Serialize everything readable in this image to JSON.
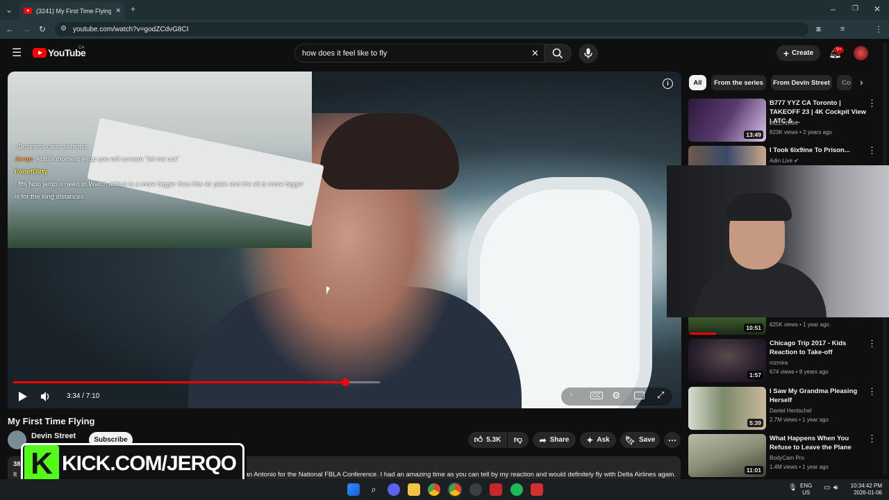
{
  "browser": {
    "tab_title": "(3241) My First Time Flying - Yo",
    "url": "youtube.com/watch?v=godZCdvG8CI",
    "profile_initial": "J"
  },
  "youtube": {
    "logo_text": "YouTube",
    "region": "CA",
    "search_value": "how does it feel like to fly",
    "create_label": "Create",
    "notification_count": "9+"
  },
  "player": {
    "time": "3:34 / 7:10",
    "progress_fraction": 0.498,
    "buffered_fraction": 0.55,
    "chat": [
      {
        "user": "",
        "message": ": Business class is better"
      },
      {
        "user": "Jerqo",
        "message": ": At this moment jerqo you will scream \"let me out\""
      },
      {
        "user": "PanetDirty",
        "message": ""
      },
      {
        "user": "",
        "message": ": ffts Noo jerqo u need to Watch airbus is a more bigger then this air plain and the sit is more bigger is for the long distances"
      }
    ]
  },
  "video": {
    "title": "My First Time Flying",
    "channel": "Devin Street",
    "subscribers": "ribers",
    "subscribe_label": "Subscribe",
    "likes": "5.3K",
    "share_label": "Share",
    "ask_label": "Ask",
    "save_label": "Save",
    "description_count": "38",
    "description_start": "It",
    "description_rest": "San Antonio for the National FBLA Conference. I had an amazing time as you can tell by my reaction and would definitely fly with Delta Airlines again."
  },
  "banner": {
    "k": "K",
    "text": "KICK.COM/JERQO"
  },
  "chips": [
    "All",
    "From the series",
    "From Devin Street",
    "Co"
  ],
  "recommendations": [
    {
      "title": "B777 YYZ CA Toronto | TAKEOFF 23 | 4K Cockpit View | ATC & ...",
      "channel": "INZEAIR84",
      "meta": "823K views • 2 years ago",
      "duration": "13:49",
      "thumb_color": "#5a3b6e"
    },
    {
      "title": "I Took 6ix9ine To Prison...",
      "channel": "Adin Live",
      "meta": "",
      "duration": "",
      "thumb_color": "#3a4a6a"
    },
    {
      "title": "",
      "channel": "",
      "meta": "625K views • 1 year ago",
      "duration": "10:51",
      "thumb_color": "#3d5a2a"
    },
    {
      "title": "Chicago Trip 2017 - Kids Reaction to Take-off",
      "channel": "mzmira",
      "meta": "674 views • 8 years ago",
      "duration": "1:57",
      "thumb_color": "#2a1f2e"
    },
    {
      "title": "I Saw My Grandma Pleasing Herself",
      "channel": "Daniel Hentschel",
      "meta": "2.7M views • 1 year ago",
      "duration": "5:39",
      "thumb_color": "#7b8a6a"
    },
    {
      "title": "What Happens When You Refuse to Leave the Plane",
      "channel": "BodyCam Pro",
      "meta": "1.4M views • 1 year ago",
      "duration": "11:01",
      "thumb_color": "#8a8f78"
    }
  ],
  "taskbar": {
    "lang_top": "ENG",
    "lang_bottom": "US",
    "time": "10:34:42 PM",
    "date": "2026-01-06"
  }
}
